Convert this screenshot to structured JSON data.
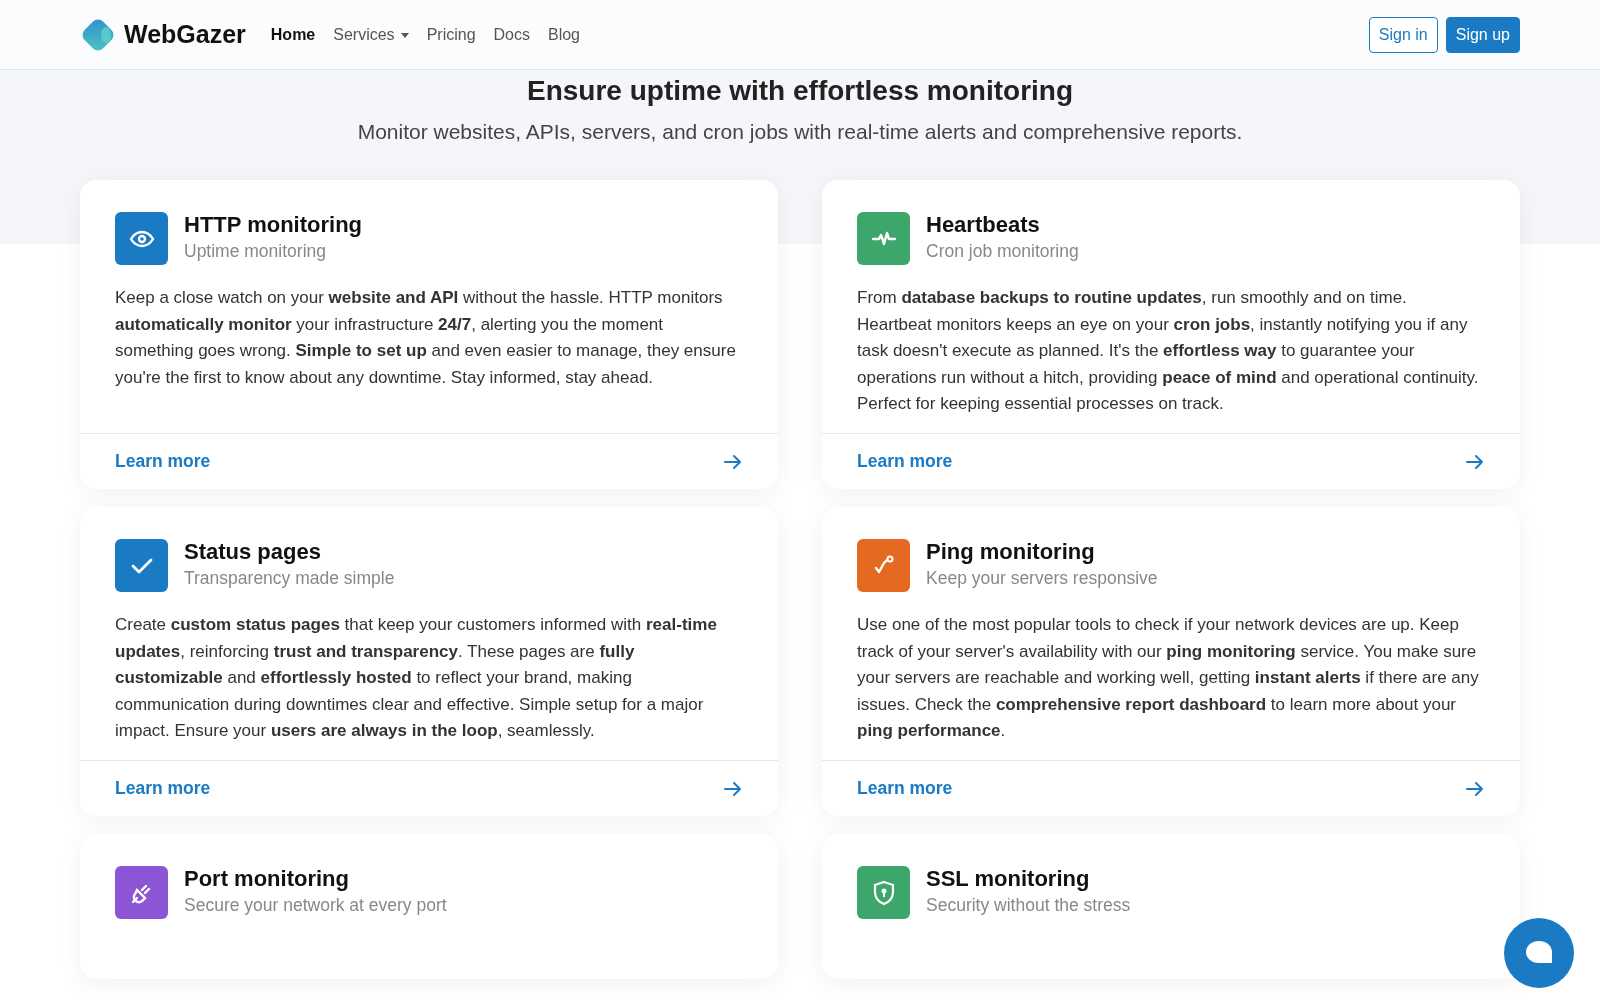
{
  "navbar": {
    "brand": "WebGazer",
    "links": [
      {
        "label": "Home",
        "selected": true,
        "dropdown": false
      },
      {
        "label": "Services",
        "selected": false,
        "dropdown": true
      },
      {
        "label": "Pricing",
        "selected": false,
        "dropdown": false
      },
      {
        "label": "Docs",
        "selected": false,
        "dropdown": false
      },
      {
        "label": "Blog",
        "selected": false,
        "dropdown": false
      }
    ],
    "buttons": [
      {
        "label": "Sign in",
        "kind": "outline"
      },
      {
        "label": "Sign up",
        "kind": "solid"
      }
    ]
  },
  "hero": {
    "title": "Ensure uptime with effortless monitoring",
    "subtitle": "Monitor websites, APIs, servers, and cron jobs with real-time alerts and comprehensive reports."
  },
  "cards": [
    {
      "color": "#1a7bc4",
      "title": "HTTP monitoring",
      "subtitle": "Uptime monitoring",
      "body": "Keep a close watch on your **website and API** without the hassle. HTTP monitors **automatically monitor** your infrastructure **24/7**, alerting you the moment something goes wrong. **Simple to set up** and even easier to manage, they ensure you're the first to know about any downtime. Stay informed, stay ahead.",
      "link": "Learn more"
    },
    {
      "color": "#3ca66b",
      "title": "Heartbeats",
      "subtitle": "Cron job monitoring",
      "body": "From **database backups to routine updates**, run smoothly and on time. Heartbeat monitors keeps an eye on your **cron jobs**, instantly notifying you if any task doesn't execute as planned. It's the **effortless way** to guarantee your operations run without a hitch, providing **peace of mind** and operational continuity. Perfect for keeping essential processes on track.",
      "link": "Learn more"
    },
    {
      "color": "#1a7bc4",
      "title": "Status pages",
      "subtitle": "Transparency made simple",
      "body": "Create **custom status pages** that keep your customers informed with **real-time updates**, reinforcing **trust and transparency**. These pages are **fully customizable** and **effortlessly hosted** to reflect your brand, making communication during downtimes clear and effective. Simple setup for a major impact. Ensure your **users are always in the loop**, seamlessly.",
      "link": "Learn more"
    },
    {
      "color": "#e46a22",
      "title": "Ping monitoring",
      "subtitle": "Keep your servers responsive",
      "body": "Use one of the most popular tools to check if your network devices are up. Keep track of your server's availability with our **ping monitoring** service. You make sure your servers are reachable and working well, getting **instant alerts** if there are any issues. Check the **comprehensive report dashboard** to learn more about your **ping performance**.",
      "link": "Learn more"
    },
    {
      "color": "#8b55d6",
      "title": "Port monitoring",
      "subtitle": "Secure your network at every port"
    },
    {
      "color": "#3ca66b",
      "title": "SSL monitoring",
      "subtitle": "Security without the stress"
    }
  ]
}
